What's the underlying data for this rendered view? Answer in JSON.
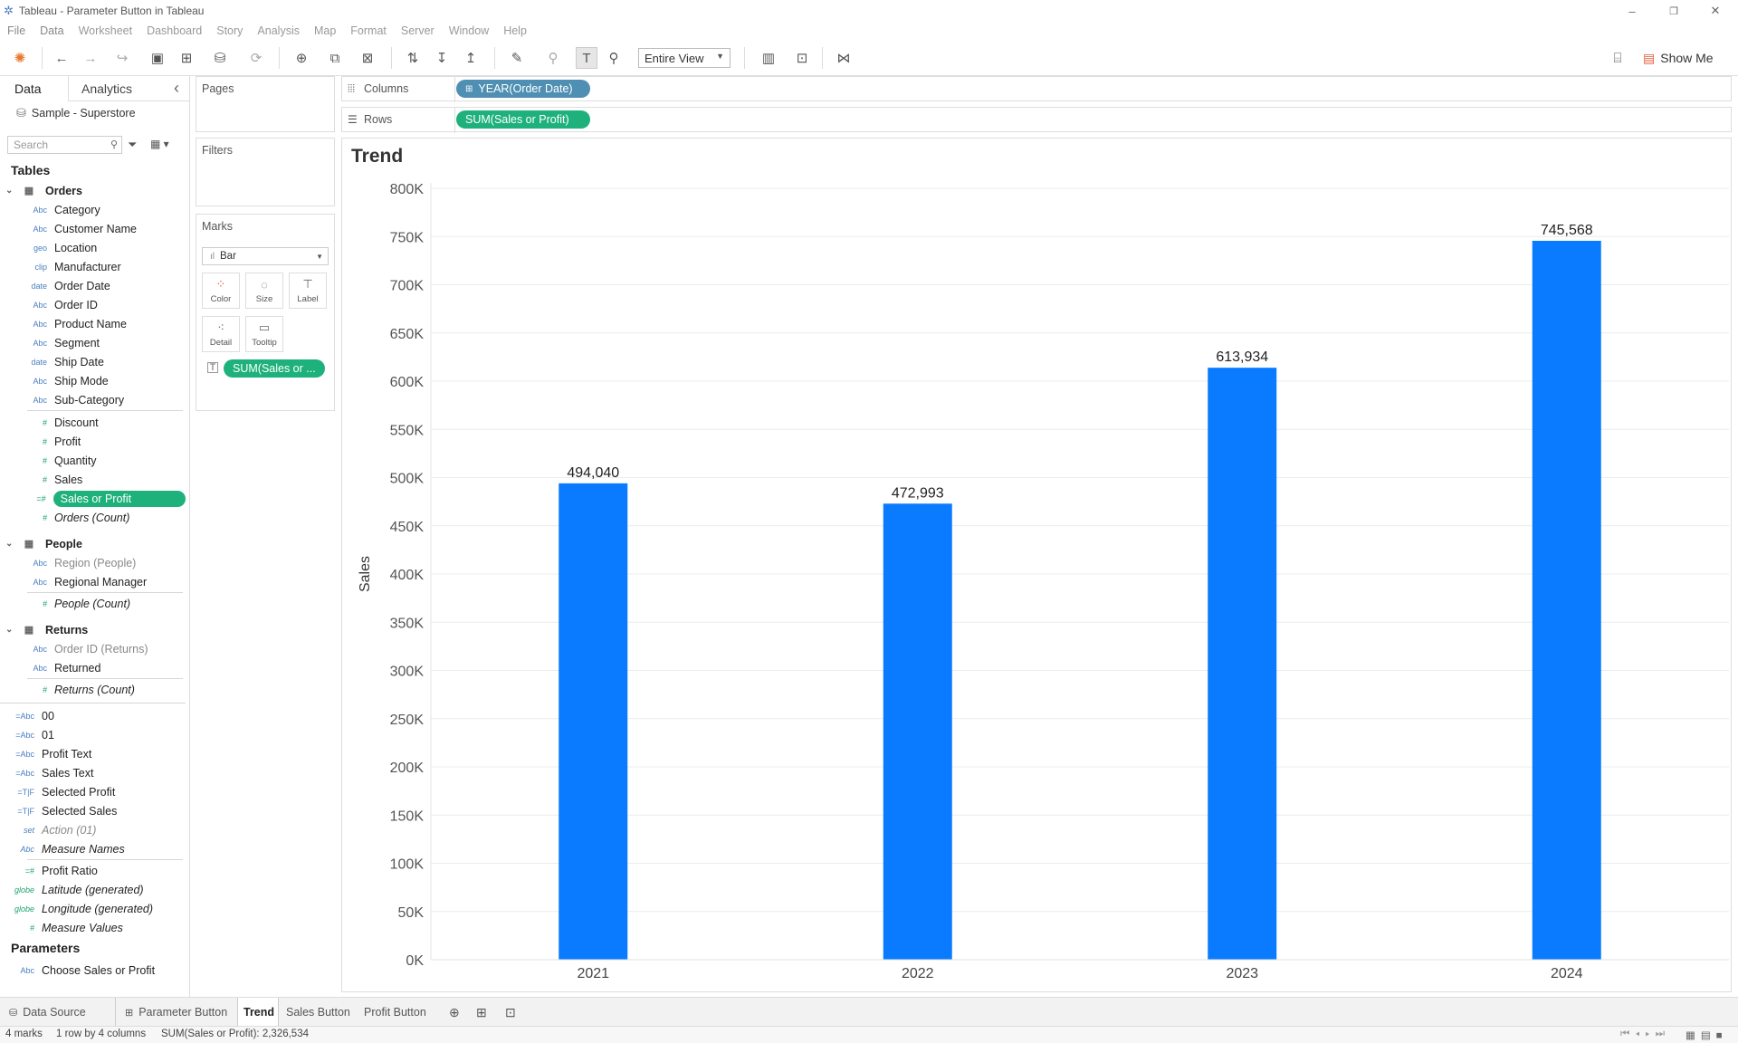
{
  "window": {
    "title": "Tableau - Parameter Button in Tableau",
    "minimize": "–",
    "restore": "❐",
    "close": "✕"
  },
  "menu": [
    "File",
    "Data",
    "Worksheet",
    "Dashboard",
    "Story",
    "Analysis",
    "Map",
    "Format",
    "Server",
    "Window",
    "Help"
  ],
  "toolbar": {
    "view_select": "Entire View",
    "show_me": "Show Me"
  },
  "datapane": {
    "tab_data": "Data",
    "tab_analytics": "Analytics",
    "collapse": "‹",
    "datasource": "Sample - Superstore",
    "search_placeholder": "Search",
    "tables_header": "Tables",
    "orders": {
      "label": "Orders",
      "fields": [
        {
          "type": "Abc",
          "name": "Category"
        },
        {
          "type": "Abc",
          "name": "Customer Name"
        },
        {
          "type": "geo",
          "name": "Location"
        },
        {
          "type": "clip",
          "name": "Manufacturer"
        },
        {
          "type": "date",
          "name": "Order Date"
        },
        {
          "type": "Abc",
          "name": "Order ID"
        },
        {
          "type": "Abc",
          "name": "Product Name"
        },
        {
          "type": "Abc",
          "name": "Segment"
        },
        {
          "type": "date",
          "name": "Ship Date"
        },
        {
          "type": "Abc",
          "name": "Ship Mode"
        },
        {
          "type": "Abc",
          "name": "Sub-Category"
        }
      ],
      "measures": [
        {
          "type": "#",
          "name": "Discount"
        },
        {
          "type": "#",
          "name": "Profit"
        },
        {
          "type": "#",
          "name": "Quantity"
        },
        {
          "type": "#",
          "name": "Sales"
        },
        {
          "type": "=#",
          "name": "Sales or Profit"
        },
        {
          "type": "#",
          "name": "Orders (Count)"
        }
      ]
    },
    "people": {
      "label": "People",
      "fields": [
        {
          "type": "Abc",
          "name": "Region (People)"
        },
        {
          "type": "Abc",
          "name": "Regional Manager"
        },
        {
          "type": "#",
          "name": "People (Count)"
        }
      ]
    },
    "returns": {
      "label": "Returns",
      "fields": [
        {
          "type": "Abc",
          "name": "Order ID (Returns)"
        },
        {
          "type": "Abc",
          "name": "Returned"
        },
        {
          "type": "#",
          "name": "Returns (Count)"
        }
      ]
    },
    "calcs": [
      {
        "type": "=Abc",
        "name": "00"
      },
      {
        "type": "=Abc",
        "name": "01"
      },
      {
        "type": "=Abc",
        "name": "Profit Text"
      },
      {
        "type": "=Abc",
        "name": "Sales Text"
      },
      {
        "type": "=T|F",
        "name": "Selected Profit"
      },
      {
        "type": "=T|F",
        "name": "Selected Sales"
      },
      {
        "type": "set",
        "name": "Action (01)"
      },
      {
        "type": "Abc",
        "name": "Measure Names"
      },
      {
        "type": "=#",
        "name": "Profit Ratio"
      },
      {
        "type": "globe",
        "name": "Latitude (generated)"
      },
      {
        "type": "globe",
        "name": "Longitude (generated)"
      },
      {
        "type": "#",
        "name": "Measure Values"
      }
    ],
    "parameters_header": "Parameters",
    "parameters": [
      {
        "type": "Abc",
        "name": "Choose Sales or Profit"
      }
    ]
  },
  "shelves": {
    "pages": "Pages",
    "filters": "Filters",
    "marks": "Marks",
    "mark_type": "Bar",
    "mark_buttons": [
      "Color",
      "Size",
      "Label",
      "Detail",
      "Tooltip"
    ],
    "mark_pill": "SUM(Sales or ...",
    "columns_label": "Columns",
    "columns_pill": "YEAR(Order Date)",
    "rows_label": "Rows",
    "rows_pill": "SUM(Sales or Profit)"
  },
  "chart_data": {
    "type": "bar",
    "title": "Trend",
    "categories": [
      "2021",
      "2022",
      "2023",
      "2024"
    ],
    "values": [
      494040,
      472993,
      613934,
      745568
    ],
    "value_labels": [
      "494,040",
      "472,993",
      "613,934",
      "745,568"
    ],
    "ylabel": "Sales",
    "xlabel": "",
    "ylim": [
      0,
      800000
    ],
    "yticks": [
      0,
      50000,
      100000,
      150000,
      200000,
      250000,
      300000,
      350000,
      400000,
      450000,
      500000,
      550000,
      600000,
      650000,
      700000,
      750000,
      800000
    ],
    "ytick_labels": [
      "0K",
      "50K",
      "100K",
      "150K",
      "200K",
      "250K",
      "300K",
      "350K",
      "400K",
      "450K",
      "500K",
      "550K",
      "600K",
      "650K",
      "700K",
      "750K",
      "800K"
    ],
    "bar_color": "#0a7bff",
    "grid": true
  },
  "bottom_tabs": {
    "data_source": "Data Source",
    "sheets": [
      "Parameter Button",
      "Trend",
      "Sales Button",
      "Profit Button"
    ],
    "active": "Trend"
  },
  "status": {
    "marks": "4 marks",
    "dims": "1 row by 4 columns",
    "sum": "SUM(Sales or Profit): 2,326,534"
  }
}
